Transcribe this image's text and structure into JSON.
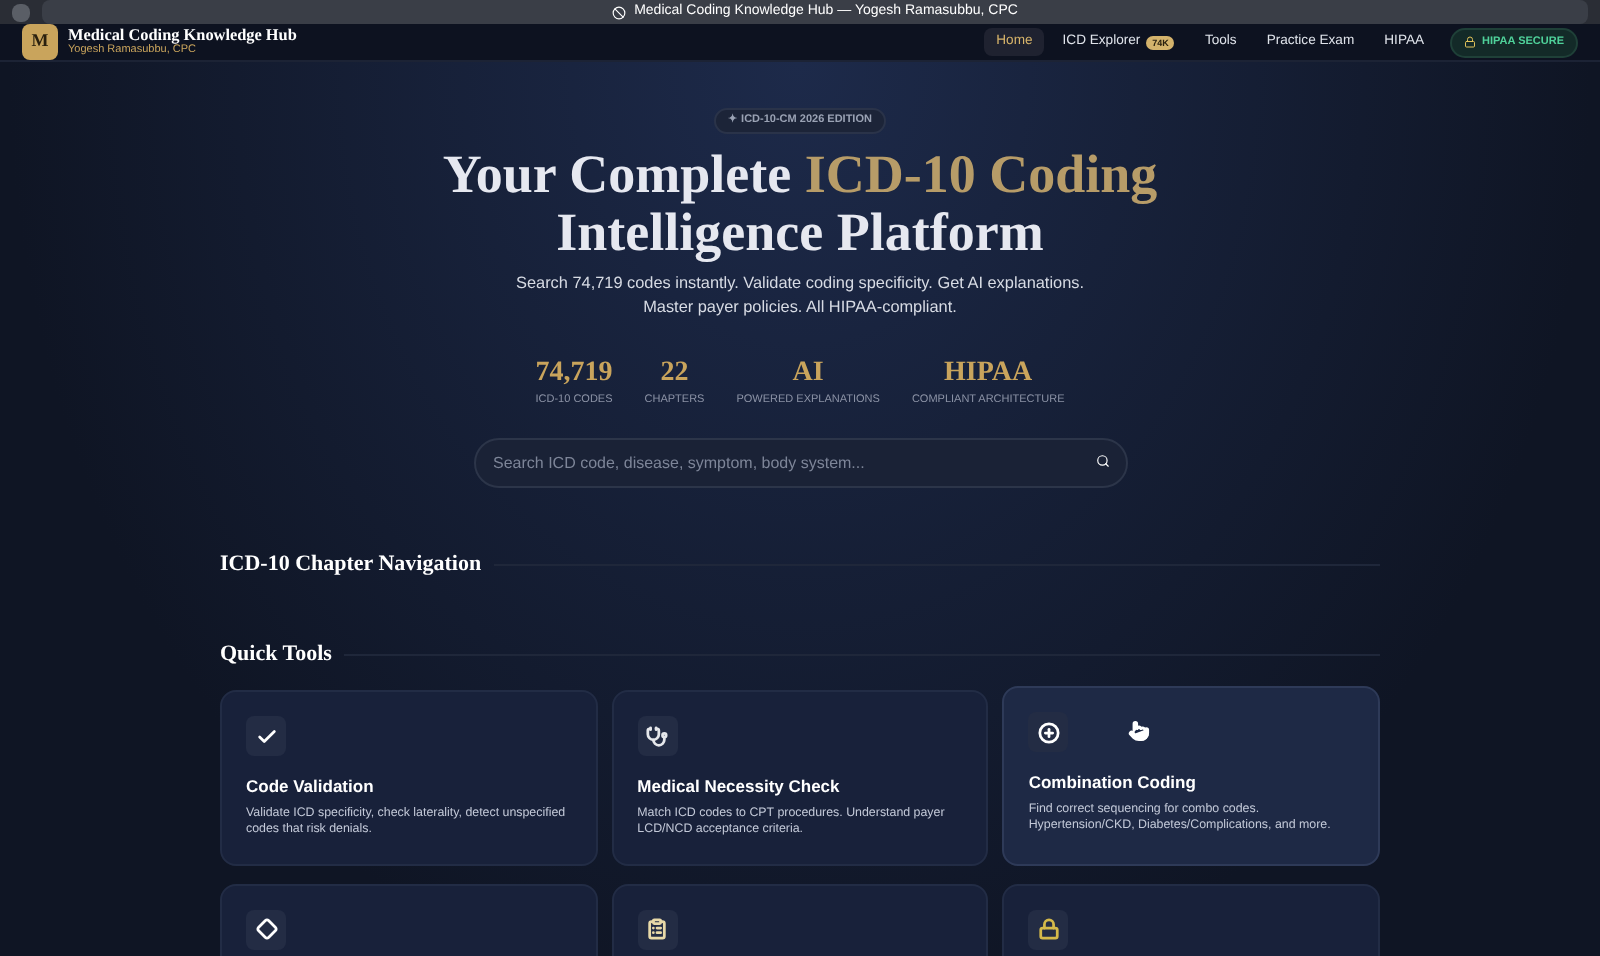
{
  "browser": {
    "title": "Medical Coding Knowledge Hub — Yogesh Ramasubbu, CPC"
  },
  "header": {
    "logo_letter": "M",
    "site_title": "Medical Coding Knowledge Hub",
    "subtitle": "Yogesh Ramasubbu, CPC",
    "nav": [
      {
        "label": "Home",
        "selected": true
      },
      {
        "label": "ICD Explorer",
        "badge": "74K",
        "selected": false
      },
      {
        "label": "Tools",
        "selected": false
      },
      {
        "label": "Practice Exam",
        "selected": false
      },
      {
        "label": "HIPAA",
        "selected": false
      }
    ],
    "secure_badge": "HIPAA SECURE"
  },
  "hero": {
    "edition_badge": "✦ ICD-10-CM 2026 EDITION",
    "title_start": "Your Complete ",
    "title_highlight": "ICD-10 Coding",
    "title_end": "Intelligence Platform",
    "description": "Search 74,719 codes instantly. Validate coding specificity. Get AI explanations. Master payer policies. All HIPAA-compliant.",
    "stats": [
      {
        "value": "74,719",
        "label": "ICD-10 CODES"
      },
      {
        "value": "22",
        "label": "CHAPTERS"
      },
      {
        "value": "AI",
        "label": "POWERED EXPLANATIONS"
      },
      {
        "value": "HIPAA",
        "label": "COMPLIANT ARCHITECTURE"
      }
    ],
    "search": {
      "placeholder": "Search ICD code, disease, symptom, body system..."
    }
  },
  "chapter_navigation": {
    "heading": "ICD-10 Chapter Navigation"
  },
  "quick_tools": {
    "heading": "Quick Tools",
    "cards": [
      {
        "kind": "check",
        "title": "Code Validation",
        "description": "Validate ICD specificity, check laterality, detect unspecified codes that risk denials.",
        "selected": false
      },
      {
        "kind": "caduceus",
        "title": "Medical Necessity Check",
        "description": "Match ICD codes to CPT procedures. Understand payer LCD/NCD acceptance criteria.",
        "selected": false
      },
      {
        "kind": "combo",
        "title": "Combination Coding",
        "description": "Find correct sequencing for combo codes. Hypertension/CKD, Diabetes/Complications, and more.",
        "selected": true
      },
      {
        "kind": "diamond",
        "selected": false
      },
      {
        "kind": "clipboard",
        "selected": false
      },
      {
        "kind": "lock",
        "selected": false
      }
    ]
  }
}
